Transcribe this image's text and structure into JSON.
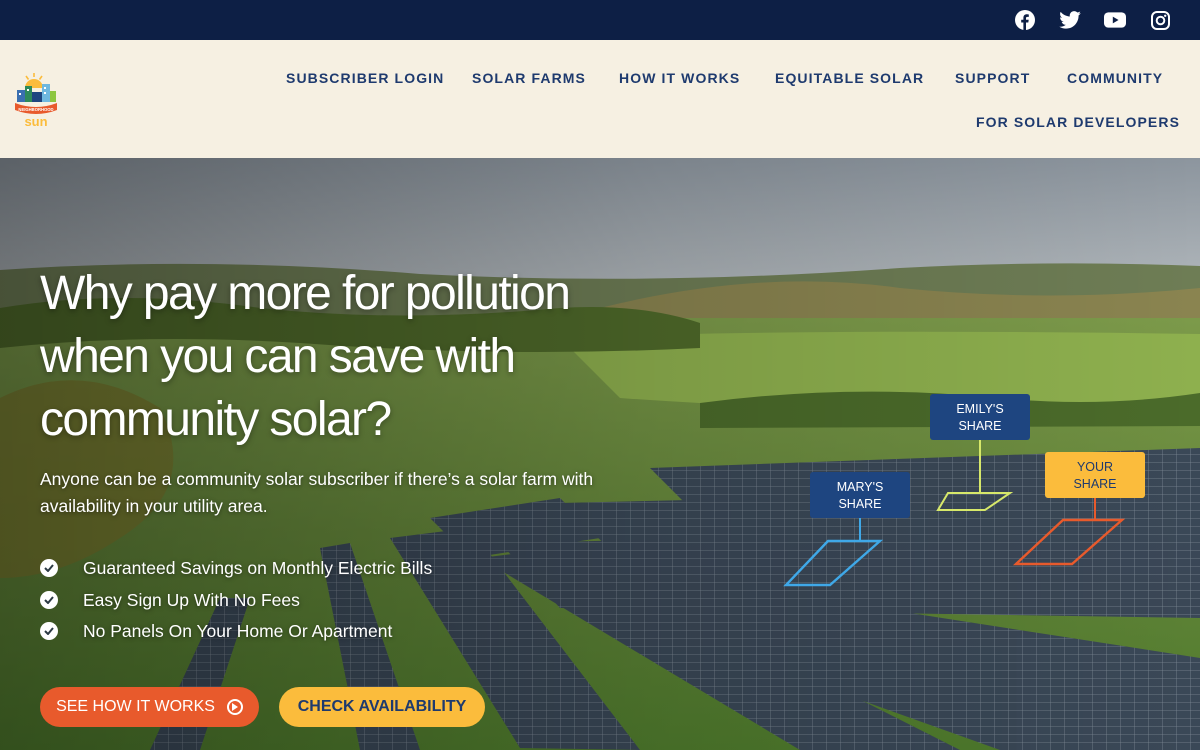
{
  "social": {
    "facebook": "facebook-icon",
    "twitter": "twitter-icon",
    "youtube": "youtube-icon",
    "instagram": "instagram-icon"
  },
  "logo": {
    "text_top": "NEIGHBORHOOD",
    "text_bottom": "sun"
  },
  "nav": {
    "subscriber_login": "SUBSCRIBER LOGIN",
    "solar_farms": "SOLAR FARMS",
    "how_it_works": "HOW IT WORKS",
    "equitable_solar": "EQUITABLE SOLAR",
    "support": "SUPPORT",
    "community": "COMMUNITY",
    "for_developers": "FOR SOLAR DEVELOPERS"
  },
  "hero": {
    "title_line1": "Why pay more for pollution",
    "title_line2": "when you can save with",
    "title_line3": "community solar?",
    "subtitle": "Anyone can be a community solar subscriber if there’s a solar farm with availability in your utility area.",
    "features": [
      "Guaranteed Savings on Monthly Electric Bills",
      "Easy Sign Up With No Fees",
      "No Panels On Your Home Or Apartment"
    ],
    "btn_how": "SEE HOW IT WORKS",
    "btn_check": "CHECK AVAILABILITY"
  },
  "shares": {
    "emily_1": "EMILY'S",
    "emily_2": "SHARE",
    "mary_1": "MARY'S",
    "mary_2": "SHARE",
    "your_1": "YOUR",
    "your_2": "SHARE"
  },
  "colors": {
    "topbar": "#0d1f45",
    "header_bg": "#f6f0e2",
    "nav_text": "#1e3a6e",
    "btn_orange": "#e85a2c",
    "btn_yellow": "#fbbc3c",
    "share_blue": "#1e4580",
    "emily_outline": "#d7e86a",
    "mary_outline": "#3fa8e8",
    "your_outline": "#e85a2c"
  }
}
